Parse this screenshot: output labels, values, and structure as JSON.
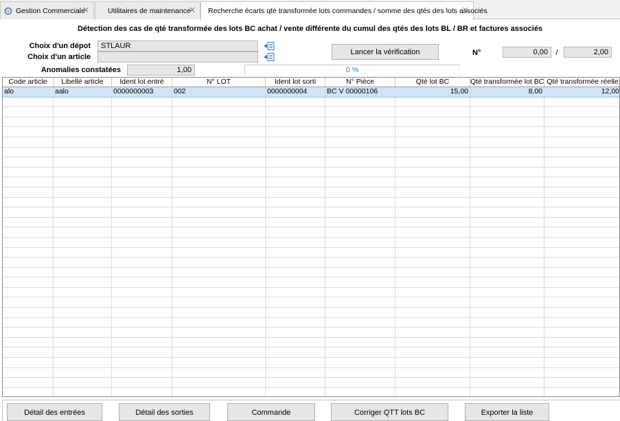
{
  "tabs": [
    {
      "label": "Gestion Commerciale",
      "closable": true,
      "active": false
    },
    {
      "label": "Utilitaires de maintenance",
      "closable": true,
      "active": false
    },
    {
      "label": "Recherche écarts qté transformée lots commandes / somme des qtés des lots associés",
      "closable": true,
      "active": true
    }
  ],
  "title": "Détection des cas de qté transformée des lots BC achat / vente différente du cumul des qtés des lots BL / BR et factures associés",
  "form": {
    "depot_label": "Choix d'un dépot",
    "depot_value": "STLAUR",
    "article_label": "Choix d'un article",
    "article_value": "",
    "anomalies_label": "Anomalies constatées",
    "anomalies_value": "1,00",
    "progress_text": "0 %",
    "launch_button": "Lancer la vérification",
    "n_label": "N°",
    "n_current": "0,00",
    "n_separator": "/",
    "n_total": "2,00"
  },
  "table": {
    "columns": [
      "Code article",
      "Libellé article",
      "Ident lot entré",
      "N° LOT",
      "Ident lot sorti",
      "N° Pièce",
      "Qté lot BC",
      "Qté transformée lot BC",
      "Qté transformée réelle"
    ],
    "rows": [
      [
        "alo",
        "aalo",
        "0000000003",
        "002",
        "0000000004",
        "BC V 00000106",
        "15,00",
        "8,00",
        "12,00"
      ]
    ]
  },
  "buttons": {
    "detail_entrees": "Détail des entrées",
    "detail_sorties": "Détail des sorties",
    "commande": "Commande",
    "corriger": "Corriger QTT lots BC",
    "exporter": "Exporter la liste"
  },
  "colors": {
    "selected_row": "#cfe4f7",
    "progress_text": "#2c8ad6",
    "field_bg": "#e6e6e6"
  },
  "icons": {
    "tab_icon": "app-gear-icon",
    "lookup_icon": "list-lookup-icon",
    "close_icon": "close-icon"
  }
}
